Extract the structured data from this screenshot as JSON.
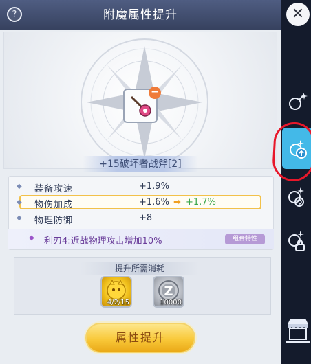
{
  "header": {
    "title": "附魔属性提升",
    "help_symbol": "?"
  },
  "item": {
    "name": "+15破坏者战斧[2]",
    "icon": "axe-icon"
  },
  "stats": [
    {
      "name": "装备攻速",
      "current": "+1.9%",
      "next": ""
    },
    {
      "name": "物伤加成",
      "current": "+1.6%",
      "arrow": "➡",
      "next": "+1.7%",
      "highlighted": true
    },
    {
      "name": "物理防御",
      "current": "+8",
      "next": ""
    }
  ],
  "combo": {
    "text": "利刃4:近战物理攻击增加10%",
    "tag": "组合特性"
  },
  "cost": {
    "title": "提升所需消耗",
    "materials": [
      {
        "icon": "gold-cat-coin-icon",
        "count": "4/2/15"
      },
      {
        "icon": "zeny-coin-icon",
        "count": "10000"
      }
    ]
  },
  "upgrade_button": {
    "label": "属性提升"
  },
  "sidebar": {
    "close_symbol": "✕",
    "icons": [
      "enchant-icon",
      "enchant-upgrade-icon",
      "enchant-reset-icon",
      "enchant-lock-icon",
      "shop-icon"
    ]
  },
  "colors": {
    "accent_gold": "#f9c93a",
    "increase_green": "#3aa64a",
    "active_tab": "#43b9e8",
    "annotation_red": "#e8172a"
  }
}
